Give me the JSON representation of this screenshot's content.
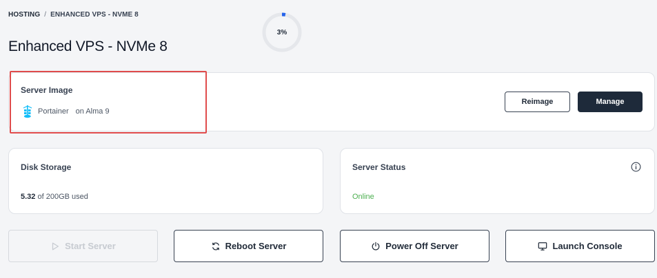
{
  "breadcrumb": {
    "root": "HOSTING",
    "separator": "/",
    "current": "ENHANCED VPS - NVME 8"
  },
  "page": {
    "title": "Enhanced VPS - NVMe 8"
  },
  "server_image": {
    "label": "Server Image",
    "name": "Portainer",
    "os": "on Alma 9",
    "icon": "portainer-icon"
  },
  "buttons": {
    "reimage": "Reimage",
    "manage": "Manage"
  },
  "disk": {
    "label": "Disk Storage",
    "used": "5.32",
    "of_text": "of 200GB used",
    "percent_label": "3%",
    "percent": 3
  },
  "status": {
    "label": "Server Status",
    "value": "Online",
    "icon": "info-icon"
  },
  "actions": {
    "start": "Start Server",
    "reboot": "Reboot Server",
    "power_off": "Power Off Server",
    "console": "Launch Console"
  },
  "colors": {
    "accent": "#1e2a3a",
    "online": "#4caf50",
    "highlight": "#e04b4b",
    "ring": "#2563eb"
  }
}
